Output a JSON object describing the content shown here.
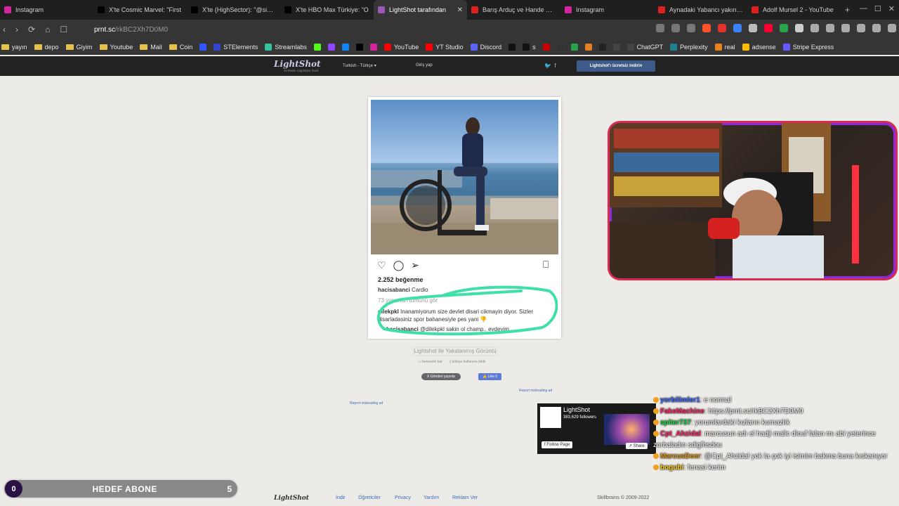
{
  "tabs": [
    {
      "label": "Instagram",
      "color": "#d6249f",
      "active": false
    },
    {
      "label": "X'te Cosmic Marvel: \"First",
      "color": "#000000",
      "active": false
    },
    {
      "label": "X'te (HighSector): \"@sinem",
      "color": "#000000",
      "active": false
    },
    {
      "label": "X'te HBO Max Türkiye: \"O",
      "color": "#000000",
      "active": false
    },
    {
      "label": "LightShot tarafından",
      "color": "#9b59b6",
      "active": true
    },
    {
      "label": "Barış Arduç ve Hande Erçe",
      "color": "#e02020",
      "active": false
    },
    {
      "label": "Instagram",
      "color": "#d6249f",
      "active": false
    },
    {
      "label": "Aynadaki Yabancı yakında",
      "color": "#e02020",
      "active": false
    },
    {
      "label": "Adolf Mursel 2 - YouTube",
      "color": "#e02020",
      "active": false
    }
  ],
  "address": {
    "domain": "prnt.sc",
    "path": "/rkBC2Xh7D0M0"
  },
  "bookmarks": [
    {
      "label": "yayın",
      "type": "folder"
    },
    {
      "label": "depo",
      "type": "folder"
    },
    {
      "label": "Giyim",
      "type": "folder"
    },
    {
      "label": "Youtube",
      "type": "folder"
    },
    {
      "label": "Mail",
      "type": "folder"
    },
    {
      "label": "Coin",
      "type": "folder"
    },
    {
      "label": "",
      "type": "icon",
      "color": "#3355ff"
    },
    {
      "label": "STElements",
      "type": "icon",
      "color": "#3344cc"
    },
    {
      "label": "Streamlabs",
      "type": "icon",
      "color": "#31c3a2"
    },
    {
      "label": "",
      "type": "icon",
      "color": "#53fc18"
    },
    {
      "label": "",
      "type": "icon",
      "color": "#9146ff"
    },
    {
      "label": "",
      "type": "icon",
      "color": "#1185fe"
    },
    {
      "label": "",
      "type": "icon",
      "color": "#000000"
    },
    {
      "label": "",
      "type": "icon",
      "color": "#d6249f"
    },
    {
      "label": "YouTube",
      "type": "icon",
      "color": "#ff0000"
    },
    {
      "label": "YT Studio",
      "type": "icon",
      "color": "#ff0000"
    },
    {
      "label": "Discord",
      "type": "icon",
      "color": "#5865f2"
    },
    {
      "label": "",
      "type": "icon",
      "color": "#111111"
    },
    {
      "label": "s",
      "type": "icon",
      "color": "#111111"
    },
    {
      "label": "",
      "type": "icon",
      "color": "#cc0000"
    },
    {
      "label": "",
      "type": "icon",
      "color": "#333333"
    },
    {
      "label": "",
      "type": "icon",
      "color": "#2aa34a"
    },
    {
      "label": "",
      "type": "icon",
      "color": "#e67e22"
    },
    {
      "label": "",
      "type": "icon",
      "color": "#222222"
    },
    {
      "label": "",
      "type": "icon",
      "color": "#444444"
    },
    {
      "label": "ChatGPT",
      "type": "icon",
      "color": "#444444"
    },
    {
      "label": "Perplexity",
      "type": "icon",
      "color": "#20808d"
    },
    {
      "label": "real",
      "type": "icon",
      "color": "#e8821e"
    },
    {
      "label": "adsense",
      "type": "icon",
      "color": "#fbbc04"
    },
    {
      "label": "Stripe Express",
      "type": "icon",
      "color": "#635bff"
    }
  ],
  "lightshot": {
    "logo": "LightShot",
    "tagline": "screen capture tool",
    "language": "Turkish - Türkçe",
    "login": "Giriş yap",
    "download": "Lightshot'ı ücretsiz indirin"
  },
  "post": {
    "likes": "2.252 beğenme",
    "caption_user": "hacisabanci",
    "caption_text": "Cardio",
    "all_comments": "73 yorumun tümünü gör",
    "comment1_user": "dilekpkl",
    "comment1_text": "Inanamiyorum size devlet disari cikmayin diyor. Sizler disarladasiniz spor bahanesiyle pes yani 👎",
    "comment2_user": "hacisabanci",
    "comment2_text": "@dilekpkl sakin ol champ.. evdeyim"
  },
  "page": {
    "caption": "Lightshot ile Yakalanmış Görüntü",
    "similar": "benzerini bul",
    "report_abuse": "kötüye kullanımı bildir",
    "tweet": "Gönderi yayınla",
    "like": "Like 0",
    "report_ad_1": "Report misleading ad",
    "report_ad_2": "Report misleading ad"
  },
  "fb_widget": {
    "name": "LightShot",
    "followers": "383,629 followers",
    "follow": "Follow Page",
    "share": "Share"
  },
  "chat": [
    {
      "user": "yorbilimler1",
      "user_color": "#3d6bff",
      "text": ": e normal"
    },
    {
      "user": "FakeMachine",
      "user_color": "#ff2b6a",
      "text": ": https://prnt.sc/rkBC2Xh7D0M0"
    },
    {
      "user": "spiter737",
      "user_color": "#27d84a",
      "text": ": yorumlardaki kızların kurnazlık"
    },
    {
      "user": "Cpt_Ahzidal",
      "user_color": "#ff2b6a",
      "text": ": marcusun adı el hadji malic diouf falan mı abi yeterince zorbaladın sdigfhsdou"
    },
    {
      "user": "MarcusDeer",
      "user_color": "#e29a1e",
      "text": ": @Cpt_Ahzidal yok la çok iyi isimim bakma buna kıskanıyor"
    },
    {
      "user": "bogubi",
      "user_color": "#ffcf1f",
      "text": ": fenasi kerim"
    }
  ],
  "goal": {
    "current": "0",
    "label": "HEDEF ABONE",
    "target": "5"
  },
  "footer": {
    "logo": "LightShot",
    "links": [
      "İndir",
      "Öğreticiler",
      "Privacy",
      "Yardım",
      "Reklam Ver"
    ],
    "copyright": "Skillbrains © 2009-2022"
  }
}
